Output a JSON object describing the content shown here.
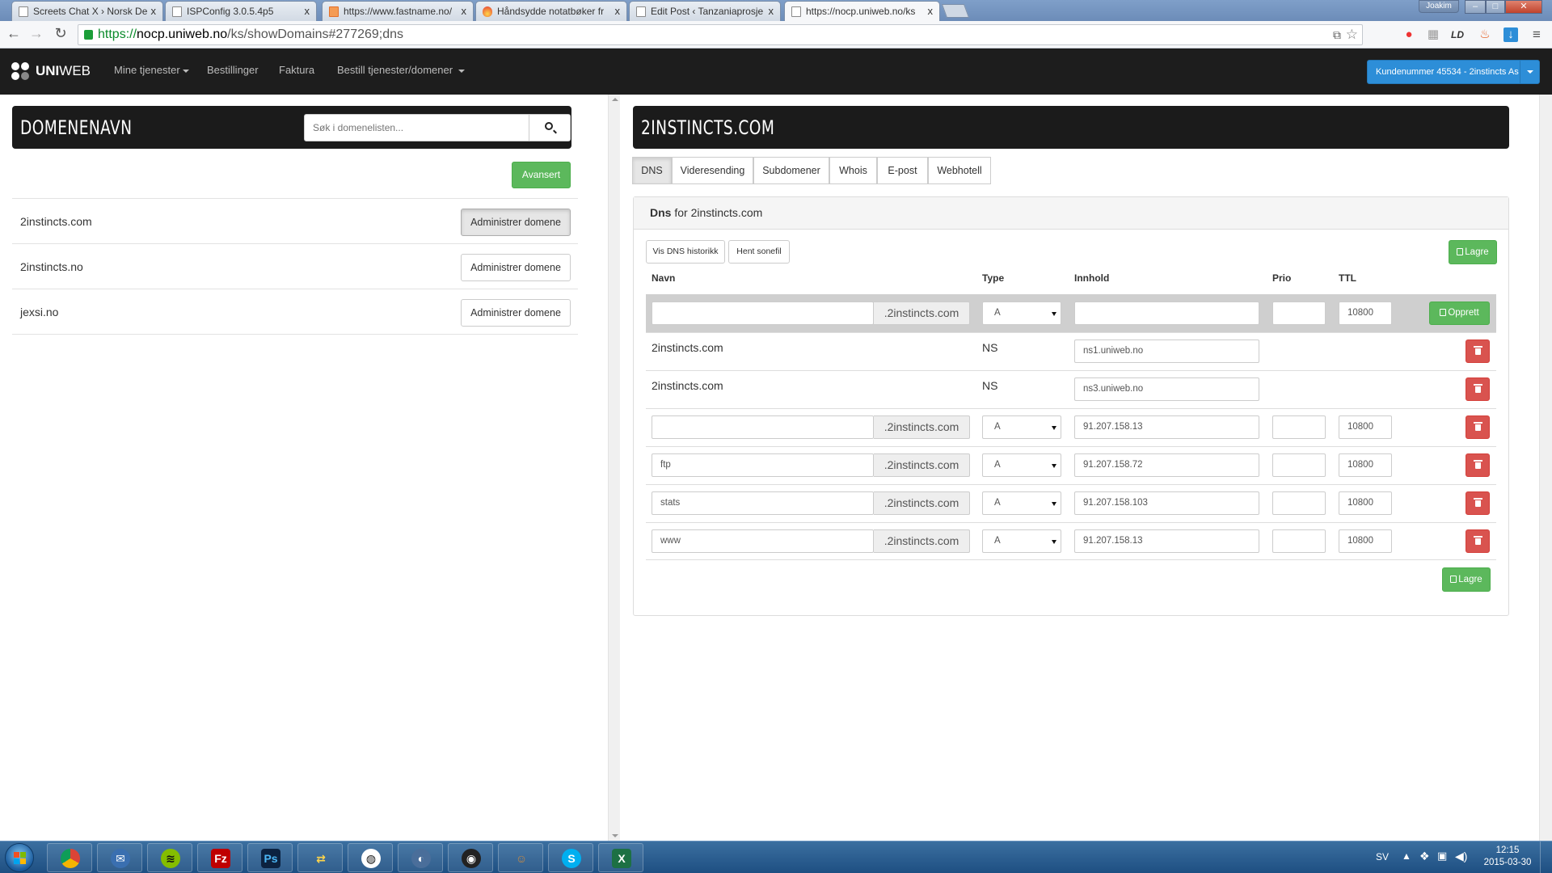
{
  "browser": {
    "tabs": [
      {
        "title": "Screets Chat X › Norsk De"
      },
      {
        "title": "ISPConfig 3.0.5.4p5"
      },
      {
        "title": "https://www.fastname.no/"
      },
      {
        "title": "Håndsydde notatbøker fr"
      },
      {
        "title": "Edit Post ‹ Tanzaniaprosje"
      },
      {
        "title": "https://nocp.uniweb.no/ks"
      }
    ],
    "tab_close": "x",
    "user": "Joakim",
    "url_scheme": "https://",
    "url_host": "nocp.uniweb.no",
    "url_path": "/ks/showDomains#277269;dns"
  },
  "nav": {
    "logo_a": "UNI",
    "logo_b": "WEB",
    "items": [
      "Mine tjenester",
      "Bestillinger",
      "Faktura",
      "Bestill tjenester/domener"
    ],
    "customer": "Kundenummer 45534 - 2instincts As"
  },
  "left": {
    "title": "DOMENENAVN",
    "search_placeholder": "Søk i domenelisten...",
    "advanced": "Avansert",
    "manage_label": "Administrer domene",
    "domains": [
      "2instincts.com",
      "2instincts.no",
      "jexsi.no"
    ]
  },
  "right": {
    "title": "2INSTINCTS.COM",
    "tabs": [
      "DNS",
      "Videresending",
      "Subdomener",
      "Whois",
      "E-post",
      "Webhotell"
    ],
    "panel_title_bold": "Dns",
    "panel_title_rest": " for 2instincts.com",
    "history_btn": "Vis DNS historikk",
    "zonefile_btn": "Hent sonefil",
    "save": "Lagre",
    "create": "Opprett",
    "columns": [
      "Navn",
      "Type",
      "Innhold",
      "Prio",
      "TTL"
    ],
    "suffix": ".2instincts.com",
    "new_row": {
      "name": "",
      "type": "A",
      "content": "",
      "prio": "",
      "ttl": "10800"
    },
    "ns_records": [
      {
        "name": "2instincts.com",
        "type": "NS",
        "content": "ns1.uniweb.no"
      },
      {
        "name": "2instincts.com",
        "type": "NS",
        "content": "ns3.uniweb.no"
      }
    ],
    "a_records": [
      {
        "name": "",
        "type": "A",
        "content": "91.207.158.13",
        "prio": "",
        "ttl": "10800"
      },
      {
        "name": "ftp",
        "type": "A",
        "content": "91.207.158.72",
        "prio": "",
        "ttl": "10800"
      },
      {
        "name": "stats",
        "type": "A",
        "content": "91.207.158.103",
        "prio": "",
        "ttl": "10800"
      },
      {
        "name": "www",
        "type": "A",
        "content": "91.207.158.13",
        "prio": "",
        "ttl": "10800"
      }
    ]
  },
  "taskbar": {
    "lang": "SV",
    "time": "12:15",
    "date": "2015-03-30"
  },
  "colors": {
    "accent_blue": "#2d8ed8",
    "success_green": "#5cb85c",
    "danger_red": "#d9534f",
    "navbar_dark": "#1d1d1d"
  }
}
